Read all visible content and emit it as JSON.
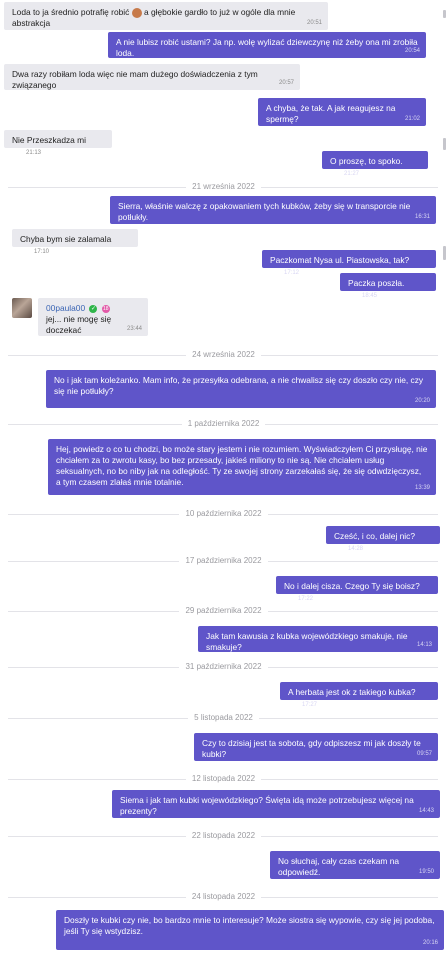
{
  "messages": [
    {
      "text": "Loda to ja średnio potrafię robić",
      "text2": "a głębokie gardło to już w ogóle dla mnie abstrakcja",
      "emoji": "woman-emoji",
      "time": "20:51"
    },
    {
      "text": "A nie lubisz robić ustami? Ja np. wolę wylizać dziewczynę niż żeby ona mi zrobiła loda.",
      "time": "20:54"
    },
    {
      "text": "Dwa razy robiłam loda więc nie mam dużego doświadczenia z tym związanego",
      "time": "20:57"
    },
    {
      "text": "A chyba, że tak. A jak reagujesz na spermę?",
      "time": "21:02"
    },
    {
      "text": "Nie Przeszkadza mi",
      "time": "21:13"
    },
    {
      "text": "O proszę, to spoko.",
      "time": "21:27"
    },
    {
      "text": "Sierra, właśnie walczę z opakowaniem tych kubków, żeby się w transporcie nie potłukły.",
      "time": "16:31"
    },
    {
      "text": "Chyba bym sie zalamala",
      "time": "17:10"
    },
    {
      "text": "Paczkomat Nysa ul. Piastowska, tak?",
      "time": "17:12"
    },
    {
      "text": "Paczka poszła.",
      "time": "18:45"
    },
    {
      "name": "00paula00",
      "badge1": "✓",
      "badge2": "18",
      "text": "jej... nie mogę się doczekać",
      "time": "23:44"
    },
    {
      "text": "No i jak tam koleżanko. Mam info, że przesyłka odebrana, a nie chwalisz się czy doszło czy nie, czy się nie potłukły?",
      "time": "20:20"
    },
    {
      "text": "Hej, powiedz o co tu chodzi, bo może stary jestem i nie rozumiem. Wyświadczyłem Ci przysługę, nie chciałem za to zwrotu kasy, bo bez przesady, jakieś miliony to nie są. Nie chciałem usług seksualnych, no bo niby jak na odległość. Ty ze swojej strony zarzekałaś się, że się odwdzięczysz, a tym czasem zlałaś mnie totalnie.",
      "time": "13:39"
    },
    {
      "text": "Cześć, i co, dalej nic?",
      "time": "14:28"
    },
    {
      "text": "No i dalej cisza. Czego Ty się boisz?",
      "time": "17:22"
    },
    {
      "text": "Jak tam kawusia z kubka wojewódzkiego smakuje, nie smakuje?",
      "time": "14:13"
    },
    {
      "text": "A herbata jest ok z takiego kubka?",
      "time": "17:27"
    },
    {
      "text": "Czy to dzisiaj jest ta sobota, gdy odpiszesz mi jak doszły te kubki?",
      "time": "09:57"
    },
    {
      "text": "Siema i jak tam kubki wojewódzkiego? Święta idą może potrzebujesz więcej na prezenty?",
      "time": "14:43"
    },
    {
      "text": "No słuchaj, cały czas czekam na odpowiedź.",
      "time": "19:50"
    },
    {
      "text": "Doszły te kubki czy nie, bo bardzo mnie to interesuje? Może siostra się wypowie, czy się jej podoba, jeśli Ty się wstydzisz.",
      "time": "20:16"
    }
  ],
  "dates": [
    "21 września 2022",
    "24 września 2022",
    "1 października 2022",
    "10 października 2022",
    "17 października 2022",
    "29 października 2022",
    "31 października 2022",
    "5 listopada 2022",
    "12 listopada 2022",
    "22 listopada 2022",
    "24 listopada 2022"
  ]
}
